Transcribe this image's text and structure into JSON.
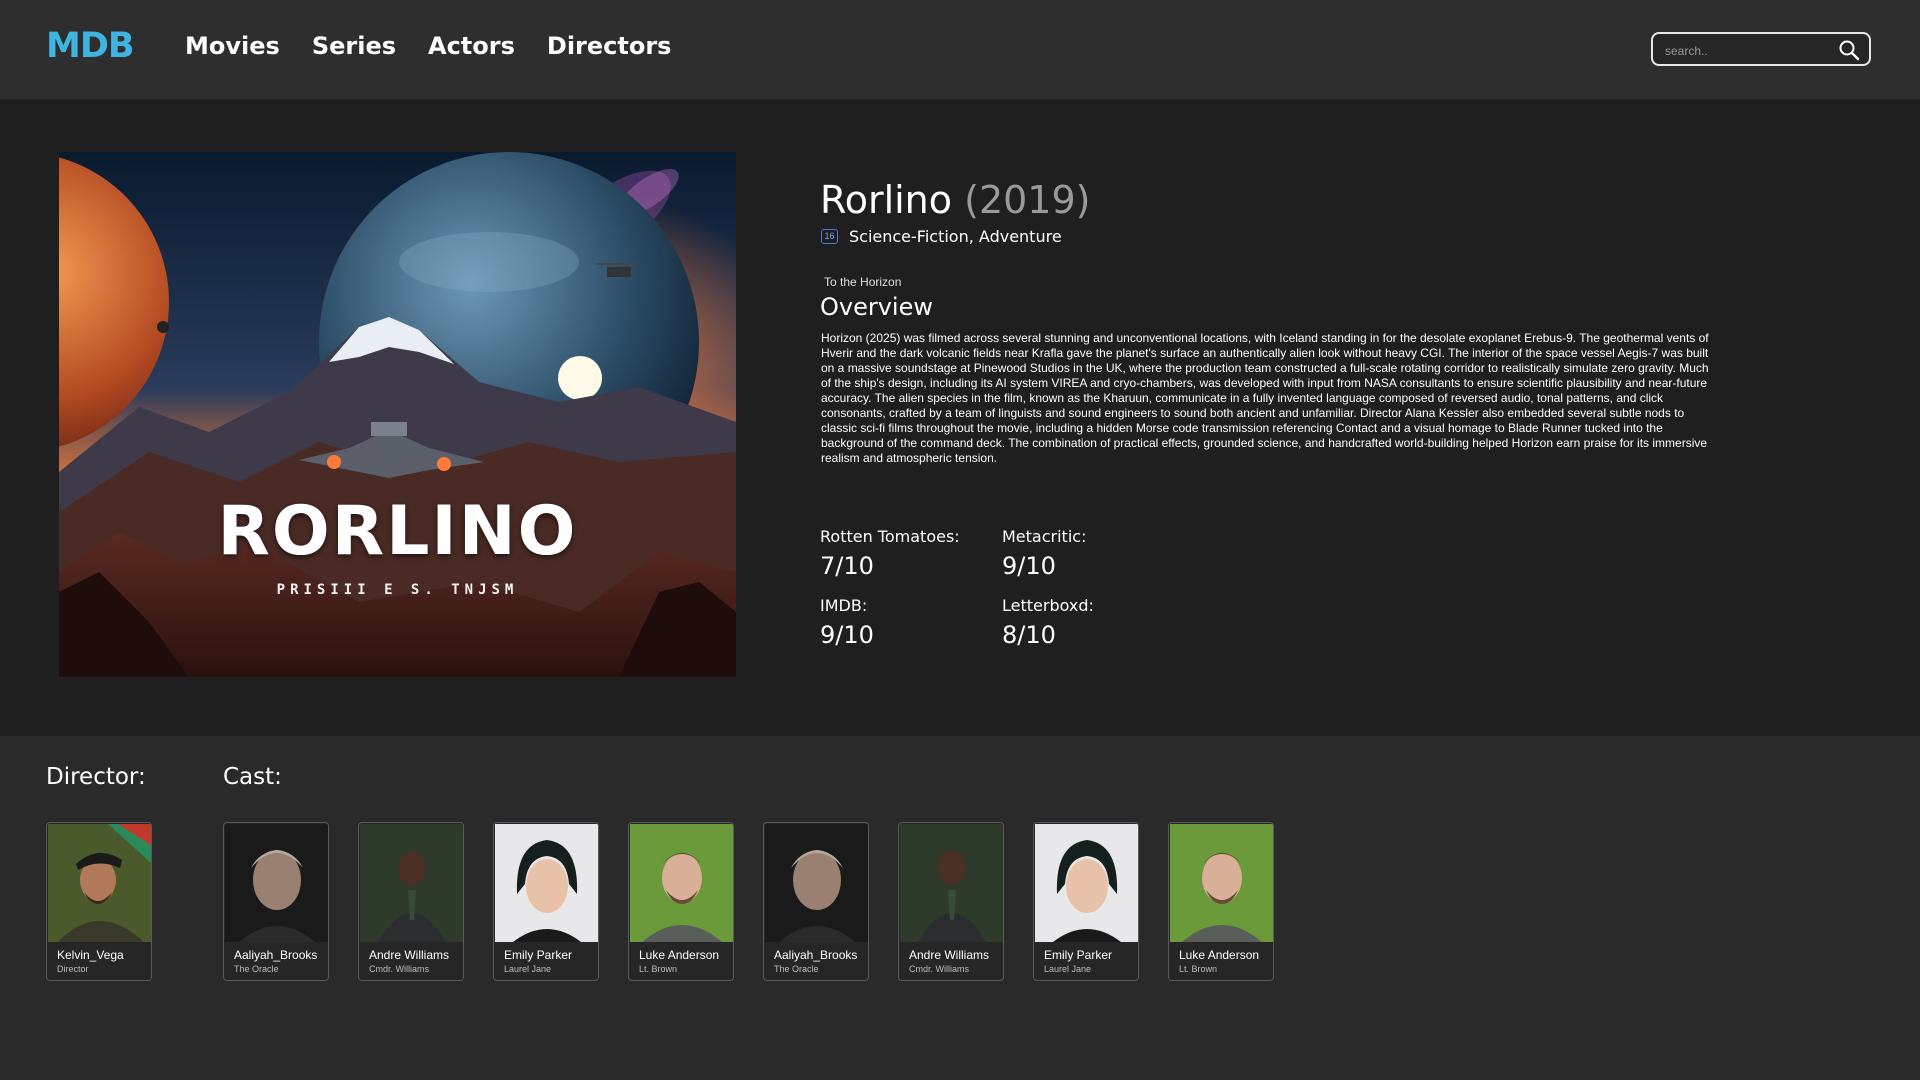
{
  "header": {
    "logo": "MDB",
    "nav": [
      "Movies",
      "Series",
      "Actors",
      "Directors"
    ],
    "search_placeholder": "search.."
  },
  "movie": {
    "poster_title": "RORLINO",
    "poster_subtitle": "PRISIII E S. TNJSM",
    "title": "Rorlino",
    "year": "(2019)",
    "age_rating": "16",
    "genres": "Science-Fiction, Adventure",
    "tagline": "To the Horizon",
    "overview_heading": "Overview",
    "overview": "Horizon (2025) was filmed across several stunning and unconventional locations, with Iceland standing in for the desolate exoplanet Erebus-9. The geothermal vents of Hverir and the dark volcanic fields near Krafla gave the planet's surface an authentically alien look without heavy CGI. The interior of the space vessel Aegis-7 was built on a massive soundstage at Pinewood Studios in the UK, where the production team constructed a full-scale rotating corridor to realistically simulate zero gravity. Much of the ship's design, including its AI system VIREA and cryo-chambers, was developed with input from NASA consultants to ensure scientific plausibility and near-future accuracy. The alien species in the film, known as the Kharuun, communicate in a fully invented language composed of reversed audio, tonal patterns, and click consonants, crafted by a team of linguists and sound engineers to sound both ancient and unfamiliar. Director Alana Kessler also embedded several subtle nods to classic sci-fi films throughout the movie, including a hidden Morse code transmission referencing Contact and a visual homage to Blade Runner tucked into the background of the command deck. The combination of practical effects, grounded science, and handcrafted world-building helped Horizon earn praise for its immersive realism and atmospheric tension."
  },
  "scores": [
    {
      "label": "Rotten Tomatoes:",
      "value": "7/10"
    },
    {
      "label": "Metacritic:",
      "value": "9/10"
    },
    {
      "label": "IMDB:",
      "value": "9/10"
    },
    {
      "label": "Letterboxd:",
      "value": "8/10"
    }
  ],
  "director_heading": "Director:",
  "cast_heading": "Cast:",
  "director": {
    "name": "Kelvin_Vega",
    "role": "Director"
  },
  "cast": [
    {
      "name": "Aaliyah_Brooks",
      "role": "The Oracle"
    },
    {
      "name": "Andre Williams",
      "role": "Cmdr. Williams"
    },
    {
      "name": "Emily Parker",
      "role": "Laurel Jane"
    },
    {
      "name": "Luke Anderson",
      "role": "Lt. Brown"
    },
    {
      "name": "Aaliyah_Brooks",
      "role": "The Oracle"
    },
    {
      "name": "Andre Williams",
      "role": "Cmdr. Williams"
    },
    {
      "name": "Emily Parker",
      "role": "Laurel Jane"
    },
    {
      "name": "Luke Anderson",
      "role": "Lt. Brown"
    }
  ],
  "colors": {
    "brand": "#3db5e0",
    "header_bg": "#2e2e2e",
    "hero_bg": "#1f1f1f",
    "page_bg": "#2a2a2a"
  }
}
